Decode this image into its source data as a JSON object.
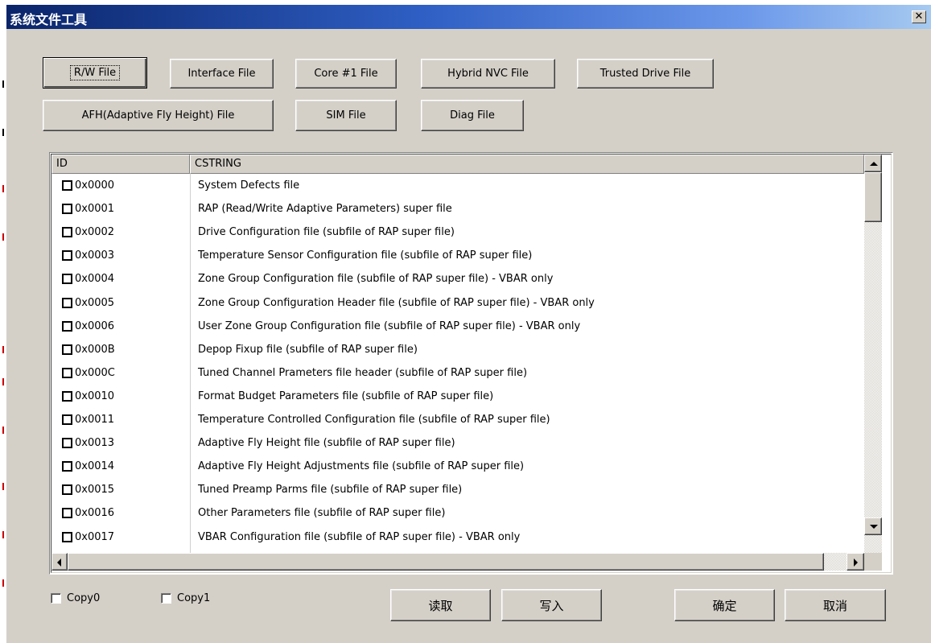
{
  "window": {
    "title": "系统文件工具",
    "close_glyph": "✕"
  },
  "file_buttons": [
    {
      "label": "R/W File"
    },
    {
      "label": "Interface File"
    },
    {
      "label": "Core #1 File"
    },
    {
      "label": "Hybrid NVC File"
    },
    {
      "label": "Trusted Drive File"
    },
    {
      "label": "AFH(Adaptive Fly Height) File"
    },
    {
      "label": "SIM File"
    },
    {
      "label": "Diag File"
    }
  ],
  "table": {
    "columns": [
      "ID",
      "CSTRING"
    ],
    "rows": [
      {
        "id": "0x0000",
        "cstring": "System Defects file"
      },
      {
        "id": "0x0001",
        "cstring": "RAP (Read/Write Adaptive Parameters) super file"
      },
      {
        "id": "0x0002",
        "cstring": "Drive Configuration file (subfile of RAP super file)"
      },
      {
        "id": "0x0003",
        "cstring": "Temperature Sensor Configuration file (subfile of RAP super file)"
      },
      {
        "id": "0x0004",
        "cstring": "Zone Group Configuration file (subfile of RAP super file) - VBAR only"
      },
      {
        "id": "0x0005",
        "cstring": "Zone Group Configuration Header file (subfile of RAP super file) - VBAR only"
      },
      {
        "id": "0x0006",
        "cstring": "User Zone Group Configuration file (subfile of RAP super file) - VBAR only"
      },
      {
        "id": "0x000B",
        "cstring": "Depop Fixup file (subfile of RAP super file)"
      },
      {
        "id": "0x000C",
        "cstring": "Tuned Channel Prameters file header (subfile of RAP super file)"
      },
      {
        "id": "0x0010",
        "cstring": "Format Budget Parameters file (subfile of RAP super file)"
      },
      {
        "id": "0x0011",
        "cstring": "Temperature Controlled Configuration file (subfile of RAP super file)"
      },
      {
        "id": "0x0013",
        "cstring": "Adaptive Fly Height file (subfile of RAP super file)"
      },
      {
        "id": "0x0014",
        "cstring": "Adaptive Fly Height Adjustments file (subfile of RAP super file)"
      },
      {
        "id": "0x0015",
        "cstring": "Tuned Preamp Parms file (subfile of RAP super file)"
      },
      {
        "id": "0x0016",
        "cstring": "Other Parameters file (subfile of RAP super file)"
      },
      {
        "id": "0x0017",
        "cstring": "VBAR Configuration file (subfile of RAP super file) - VBAR only"
      }
    ]
  },
  "options": {
    "copy0": "Copy0",
    "copy1": "Copy1"
  },
  "actions": {
    "read": "读取",
    "write": "写入",
    "ok": "确定",
    "cancel": "取消"
  }
}
